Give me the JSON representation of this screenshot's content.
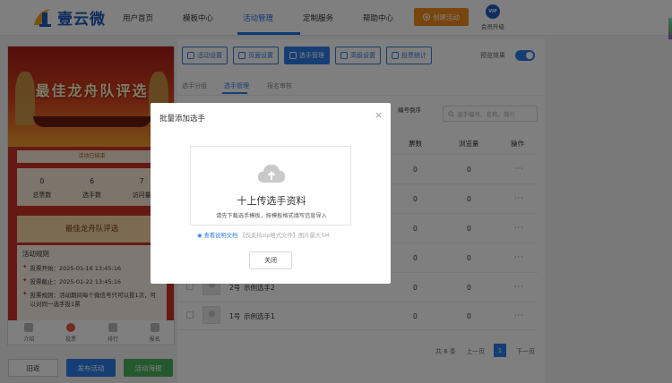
{
  "brand": {
    "name": "壹云微"
  },
  "nav": {
    "items": [
      "用户首页",
      "模板中心",
      "活动管理",
      "定制服务",
      "帮助中心"
    ],
    "create_label": "创建活动",
    "vip_label": "会员升级",
    "vip_badge": "VIP"
  },
  "preview": {
    "banner_title": "最佳龙舟队评选",
    "status": "活动已结束",
    "stats": [
      {
        "num": "0",
        "label": "总票数"
      },
      {
        "num": "6",
        "label": "选手数"
      },
      {
        "num": "7",
        "label": "访问量"
      }
    ],
    "vote_title": "最佳龙舟队评选",
    "rules_title": "活动规则",
    "rules": [
      "投票开始：2025-01-16 13:45:16",
      "投票截止：2025-01-22 13:45:16",
      "投票规则：活动期间每个微信号只可以投1次，可以对同一选手投1票"
    ],
    "bottom_nav": [
      "介绍",
      "投票",
      "排行",
      "报名"
    ]
  },
  "actions": {
    "back": "旧返",
    "publish": "发布活动",
    "poster": "活动海报"
  },
  "toolbar": [
    "活动设置",
    "页面设置",
    "选手管理",
    "高级设置",
    "投票统计"
  ],
  "preview_toggle": "预览效果",
  "subtabs": [
    "选手分组",
    "选手管理",
    "报名审核"
  ],
  "table": {
    "sort_label": "编号倒序",
    "search_placeholder": "选手编号、名称、简介",
    "headers": {
      "votes": "票数",
      "views": "浏览量",
      "ops": "操作"
    },
    "rows": [
      {
        "id": "",
        "name": "",
        "votes": "0",
        "views": "0",
        "ops": "···"
      },
      {
        "id": "",
        "name": "",
        "votes": "0",
        "views": "0",
        "ops": "···"
      },
      {
        "id": "",
        "name": "",
        "votes": "0",
        "views": "0",
        "ops": "···"
      },
      {
        "id": "",
        "name": "",
        "votes": "0",
        "views": "0",
        "ops": "···"
      },
      {
        "id": "2号",
        "name": "示例选手2",
        "votes": "0",
        "views": "0",
        "ops": "···"
      },
      {
        "id": "1号",
        "name": "示例选手1",
        "votes": "0",
        "views": "0",
        "ops": "···"
      }
    ]
  },
  "pager": {
    "total": "共 6 条",
    "prev": "上一页",
    "current": "1",
    "next": "下一页"
  },
  "modal": {
    "title": "批量添加选手",
    "close": "×",
    "upload_title": "十上传选手资料",
    "upload_sub": "请先下载选手模板，按模板格式填写信息导入",
    "help_link": "查看说明文档",
    "help_hint": "【仅支持zip格式文件】图片最大5M",
    "close_btn": "关闭"
  }
}
